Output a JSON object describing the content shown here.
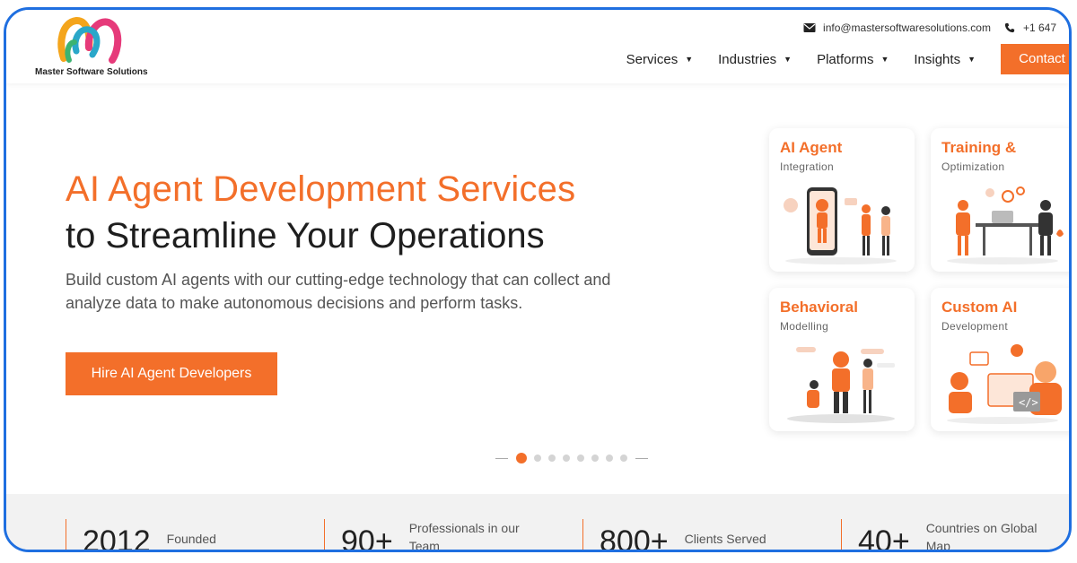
{
  "brand": {
    "name": "Master Software Solutions",
    "colors": {
      "accent": "#f36f2a",
      "frame": "#1f6fe0"
    }
  },
  "topbar": {
    "email": "info@mastersoftwaresolutions.com",
    "phone": "+1 647",
    "email_icon": "mail-icon",
    "phone_icon": "phone-icon"
  },
  "nav": {
    "items": [
      {
        "label": "Services"
      },
      {
        "label": "Industries"
      },
      {
        "label": "Platforms"
      },
      {
        "label": "Insights"
      }
    ],
    "contact_label": "Contact"
  },
  "hero": {
    "title_line1": "AI Agent Development Services",
    "title_line2": "to Streamline Your Operations",
    "description": "Build custom AI agents with our cutting-edge technology that can collect and analyze data to make autonomous decisions and perform tasks.",
    "cta_label": "Hire AI Agent Developers",
    "carousel": {
      "slides": 8,
      "active": 1
    }
  },
  "cards": [
    {
      "title": "AI Agent",
      "subtitle": "Integration"
    },
    {
      "title": "Training &",
      "subtitle": "Optimization"
    },
    {
      "title": "Behavioral",
      "subtitle": "Modelling"
    },
    {
      "title": "Custom AI",
      "subtitle": "Development"
    }
  ],
  "stats": [
    {
      "value": "2012",
      "label": "Founded"
    },
    {
      "value": "90+",
      "label": "Professionals in our Team"
    },
    {
      "value": "800+",
      "label": "Clients Served"
    },
    {
      "value": "40+",
      "label": "Countries on Global Map"
    }
  ]
}
